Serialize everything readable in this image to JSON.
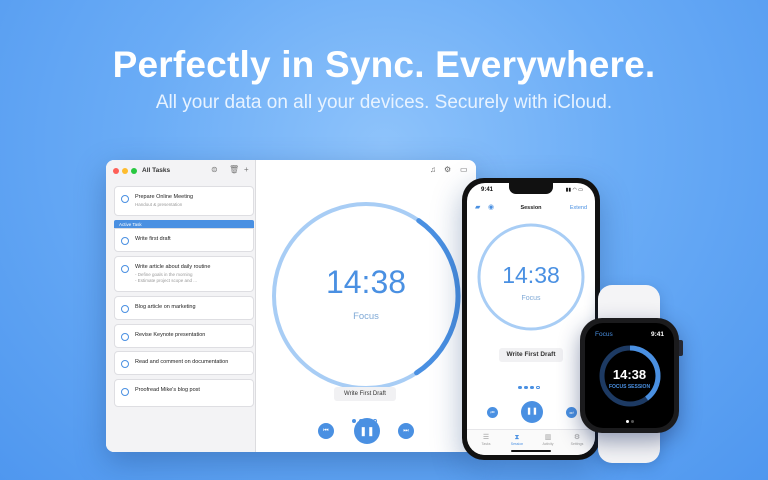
{
  "hero": {
    "title": "Perfectly in Sync. Everywhere.",
    "subtitle": "All your data on all your devices. Securely with iCloud."
  },
  "mac": {
    "sidebar_title": "All Tasks",
    "active_header": "Active Task",
    "tasks": [
      {
        "title": "Prepare Online Meeting",
        "sub": "Handout & presentation"
      },
      {
        "title": "Write first draft",
        "sub": ""
      },
      {
        "title": "Write article about daily routine",
        "sub": "- Define goals in the morning\n- Estimate project scope and ..."
      },
      {
        "title": "Blog article on marketing",
        "sub": ""
      },
      {
        "title": "Revise Keynote presentation",
        "sub": ""
      },
      {
        "title": "Read and comment on documentation",
        "sub": ""
      },
      {
        "title": "Proofread Mike's blog post",
        "sub": ""
      }
    ],
    "timer": "14:38",
    "mode": "Focus",
    "current_task": "Write First Draft",
    "progress": 0.31
  },
  "phone": {
    "clock": "9:41",
    "nav_title": "Session",
    "extend": "Extend",
    "timer": "14:38",
    "mode": "Focus",
    "current_task": "Write First Draft",
    "tabs": [
      {
        "label": "Tasks",
        "icon": "list-icon"
      },
      {
        "label": "Session",
        "icon": "hourglass-icon"
      },
      {
        "label": "Activity",
        "icon": "bar-chart-icon"
      },
      {
        "label": "Settings",
        "icon": "gear-icon"
      }
    ]
  },
  "watch": {
    "label": "Focus",
    "clock": "9:41",
    "timer": "14:38",
    "mode": "FOCUS SESSION"
  },
  "colors": {
    "accent": "#4a90e2",
    "ring_track": "#a8cdf5"
  }
}
